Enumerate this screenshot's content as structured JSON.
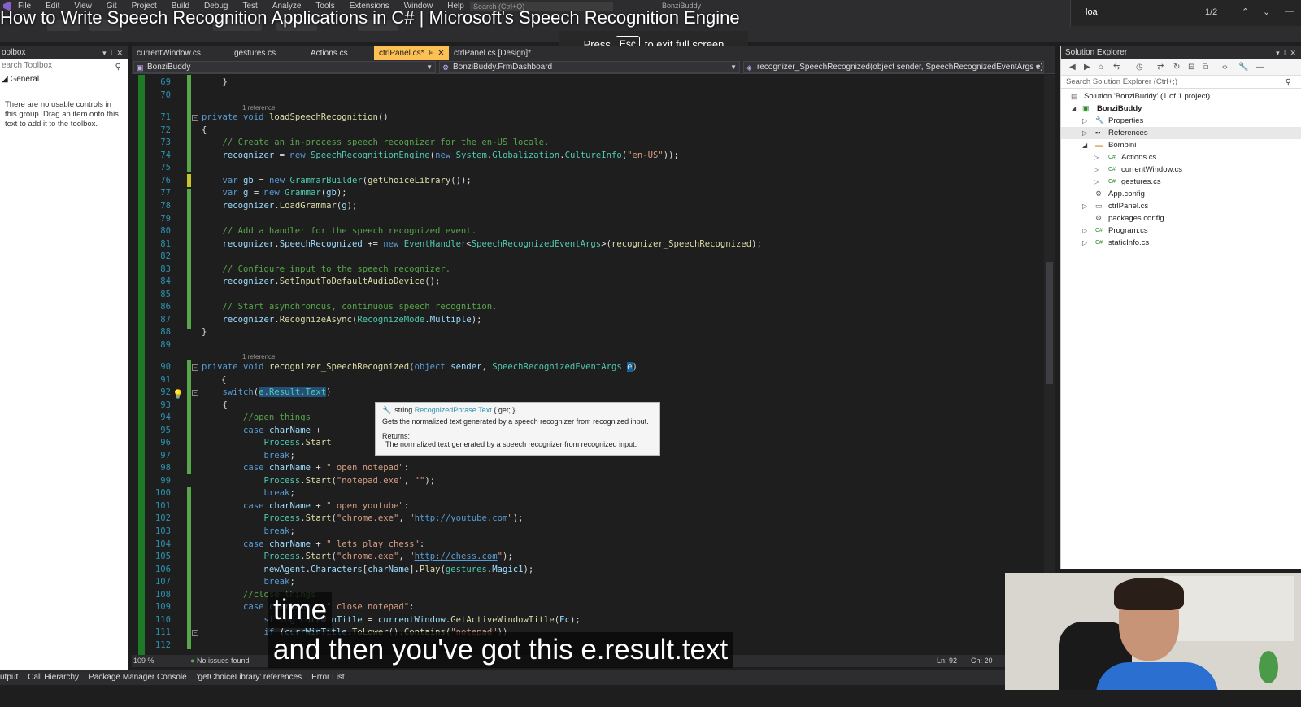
{
  "video": {
    "title": "How to Write Speech Recognition Applications in C# | Microsoft's Speech Recognition Engine",
    "captions": [
      "time",
      "and then you've got this e.result.text"
    ],
    "fullscreen_notice": {
      "press": "Press",
      "key": "Esc",
      "rest": "to exit full screen"
    }
  },
  "menu": {
    "items": [
      "File",
      "Edit",
      "View",
      "Git",
      "Project",
      "Build",
      "Debug",
      "Test",
      "Analyze",
      "Tools",
      "Extensions",
      "Window",
      "Help"
    ],
    "search_placeholder": "Search (Ctrl+Q)",
    "solution_name": "BonziBuddy"
  },
  "find": {
    "query": "loa",
    "count": "1/2"
  },
  "toolbox": {
    "title": "oolbox",
    "search_placeholder": "earch Toolbox",
    "group": "General",
    "message": "There are no usable controls in this group. Drag an item onto this text to add it to the toolbox."
  },
  "tabs": [
    {
      "label": "currentWindow.cs",
      "active": false
    },
    {
      "label": "gestures.cs",
      "active": false
    },
    {
      "label": "Actions.cs",
      "active": false
    },
    {
      "label": "ctrlPanel.cs*",
      "active": true
    },
    {
      "label": "ctrlPanel.cs [Design]*",
      "active": false
    }
  ],
  "navbar": {
    "project": "BonziBuddy",
    "class": "BonziBuddy.FrmDashboard",
    "member": "recognizer_SpeechRecognized(object sender, SpeechRecognizedEventArgs e)"
  },
  "code": {
    "ref_label": "1 reference",
    "line_numbers": [
      "69",
      "70",
      "71",
      "72",
      "73",
      "74",
      "75",
      "76",
      "77",
      "78",
      "79",
      "80",
      "81",
      "82",
      "83",
      "84",
      "85",
      "86",
      "87",
      "88",
      "89",
      "90",
      "91",
      "92",
      "93",
      "94",
      "95",
      "96",
      "97",
      "98",
      "99",
      "100",
      "101",
      "102",
      "103",
      "104",
      "105",
      "106",
      "107",
      "108",
      "109",
      "110",
      "111",
      "112"
    ]
  },
  "tooltip": {
    "kind": "string",
    "signature": "RecognizedPhrase.Text",
    "accessors": "{ get; }",
    "description": "Gets the normalized text generated by a speech recognizer from recognized input.",
    "returns_label": "Returns:",
    "returns_desc": "The normalized text generated by a speech recognizer from recognized input."
  },
  "solution_explorer": {
    "title": "Solution Explorer",
    "search_placeholder": "Search Solution Explorer (Ctrl+;)",
    "nodes": [
      {
        "label": "Solution 'BonziBuddy' (1 of 1 project)",
        "icon": "solution-icon"
      },
      {
        "label": "BonziBuddy",
        "icon": "csharp-project-icon"
      },
      {
        "label": "Properties",
        "icon": "wrench-icon"
      },
      {
        "label": "References",
        "icon": "references-icon"
      },
      {
        "label": "Bombini",
        "icon": "folder-icon"
      },
      {
        "label": "Actions.cs",
        "icon": "cs-file-icon"
      },
      {
        "label": "currentWindow.cs",
        "icon": "cs-file-icon"
      },
      {
        "label": "gestures.cs",
        "icon": "cs-file-icon"
      },
      {
        "label": "App.config",
        "icon": "config-file-icon"
      },
      {
        "label": "ctrlPanel.cs",
        "icon": "form-file-icon"
      },
      {
        "label": "packages.config",
        "icon": "config-file-icon"
      },
      {
        "label": "Program.cs",
        "icon": "cs-file-icon"
      },
      {
        "label": "staticInfo.cs",
        "icon": "cs-file-icon"
      }
    ]
  },
  "status": {
    "zoom": "109 %",
    "issues": "No issues found",
    "line": "Ln: 92",
    "col": "Ch: 20"
  },
  "bottom_tabs": [
    "utput",
    "Call Hierarchy",
    "Package Manager Console",
    "'getChoiceLibrary' references",
    "Error List"
  ]
}
